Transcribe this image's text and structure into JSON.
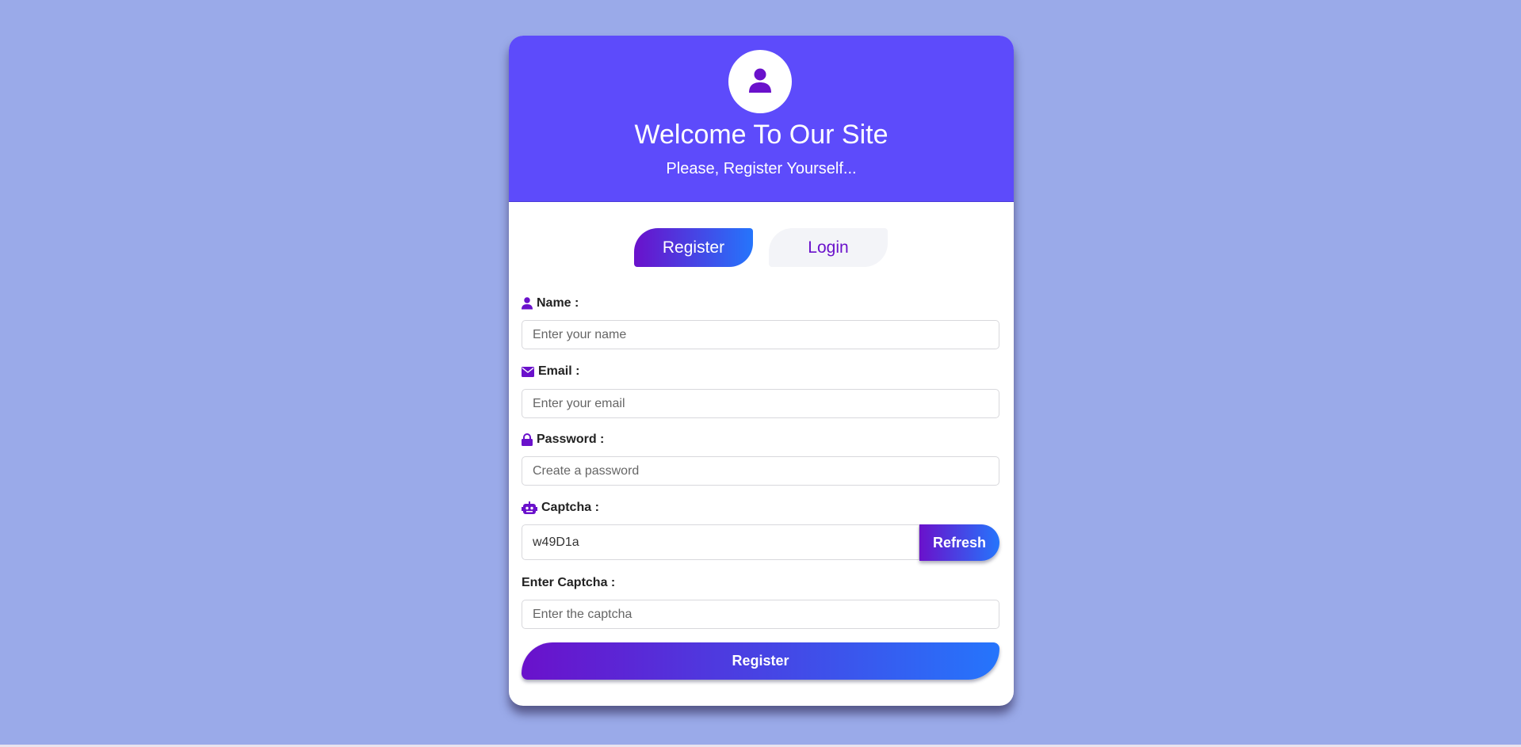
{
  "header": {
    "avatar_icon": "user-icon",
    "title": "Welcome To Our Site",
    "subtitle": "Please, Register Yourself..."
  },
  "tabs": {
    "active": "Register",
    "register_label": "Register",
    "login_label": "Login"
  },
  "form": {
    "name": {
      "icon": "user-icon",
      "label": "Name :",
      "placeholder": "Enter your name",
      "value": ""
    },
    "email": {
      "icon": "envelope-icon",
      "label": "Email :",
      "placeholder": "Enter your email",
      "value": ""
    },
    "password": {
      "icon": "lock-icon",
      "label": "Password :",
      "placeholder": "Create a password",
      "value": ""
    },
    "captcha": {
      "icon": "robot-icon",
      "label": "Captcha :",
      "code": "w49D1a",
      "refresh_label": "Refresh"
    },
    "captcha_entry": {
      "label": "Enter Captcha :",
      "placeholder": "Enter the captcha",
      "value": ""
    },
    "submit_label": "Register"
  },
  "colors": {
    "page_background": "#9aaae9",
    "header_background": "#5d4bfb",
    "accent": "#6a11cb",
    "gradient_start": "#6a11cb",
    "gradient_end": "#2575fc"
  }
}
